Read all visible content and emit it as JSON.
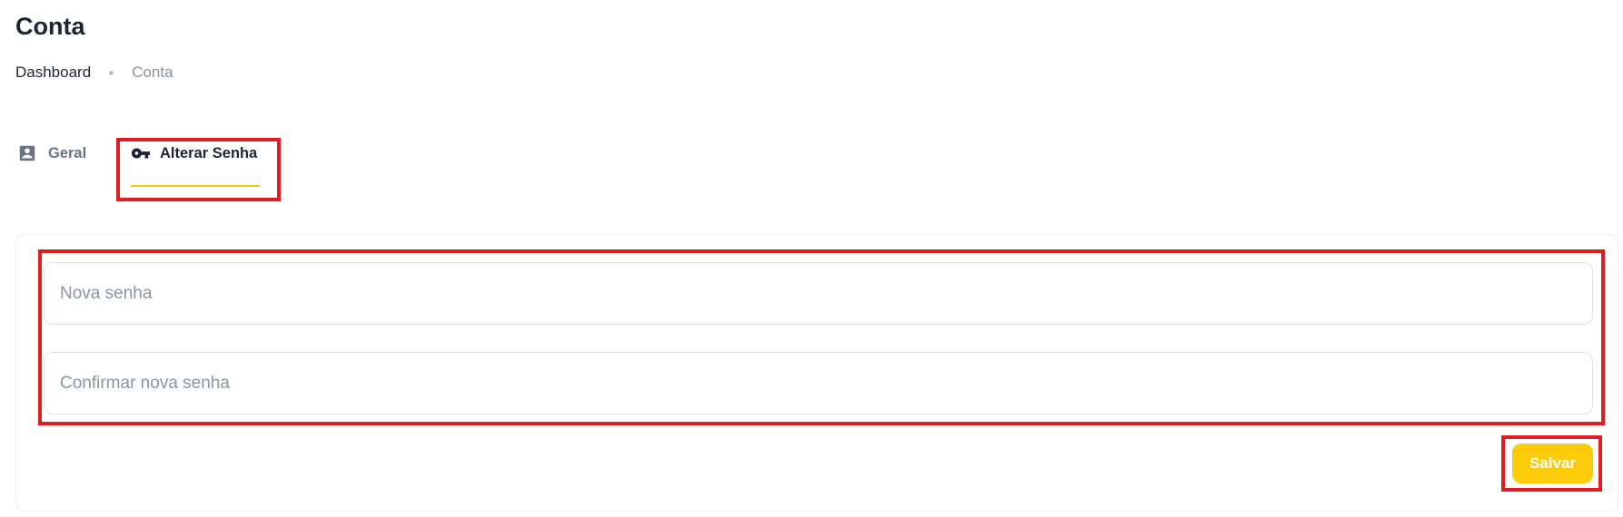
{
  "page": {
    "title": "Conta"
  },
  "breadcrumb": {
    "items": [
      "Dashboard",
      "Conta"
    ]
  },
  "tabs": [
    {
      "label": "Geral",
      "icon": "account-box-icon",
      "active": false
    },
    {
      "label": "Alterar Senha",
      "icon": "key-icon",
      "active": true
    }
  ],
  "form": {
    "new_password": {
      "placeholder": "Nova senha",
      "value": ""
    },
    "confirm_password": {
      "placeholder": "Confirmar nova senha",
      "value": ""
    },
    "save_label": "Salvar"
  },
  "colors": {
    "accent": "#fccc0b",
    "tab_underline": "#f5c518",
    "highlight": "#e11d24",
    "title_text": "#1c2536",
    "muted_text": "#8a93a0"
  }
}
